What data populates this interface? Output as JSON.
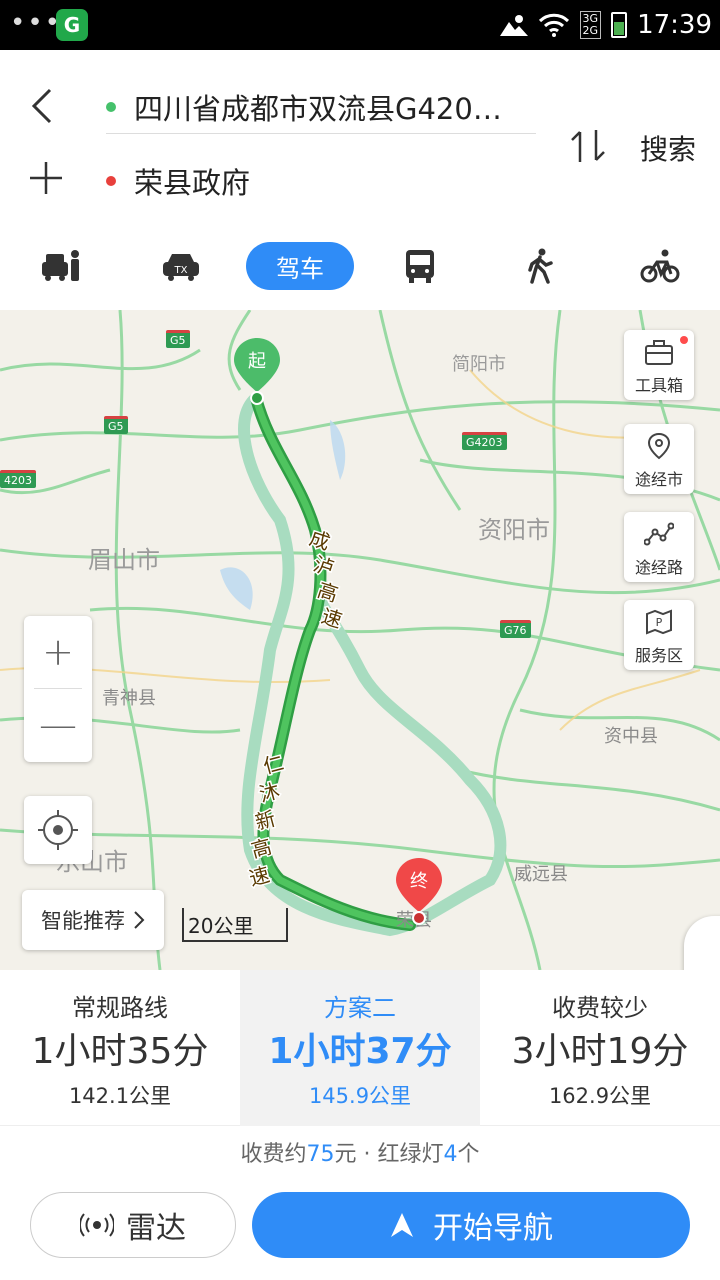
{
  "status_bar": {
    "dots": "•••",
    "app_icon": "G",
    "network": "3G\n2G",
    "time": "17:39"
  },
  "header": {
    "back_icon": "chevron-left-icon",
    "add_icon": "plus-icon",
    "start": "四川省成都市双流县G420…",
    "end": "荣县政府",
    "search": "搜索"
  },
  "modes": {
    "items": [
      "taxi-share-icon",
      "taxi-icon",
      "驾车",
      "bus-icon",
      "walk-icon",
      "bike-icon"
    ],
    "active_label": "驾车"
  },
  "map": {
    "cities": [
      "简阳市",
      "资阳市",
      "眉山市",
      "青神县",
      "资中县",
      "威远县",
      "乐山市",
      "荣县"
    ],
    "shields": [
      "G5",
      "G5",
      "G4203",
      "4203",
      "G76"
    ],
    "route_labels": [
      "成泸高速",
      "仁沐新高速"
    ],
    "start_marker": "起",
    "end_marker": "终",
    "tools": [
      "工具箱",
      "途经市",
      "途经路",
      "服务区"
    ],
    "zoom_in": "+",
    "zoom_out": "—",
    "smart": "智能推荐",
    "scale": "20公里"
  },
  "routes": [
    {
      "name": "常规路线",
      "time": "1小时35分",
      "dist": "142.1公里"
    },
    {
      "name": "方案二",
      "time": "1小时37分",
      "dist": "145.9公里"
    },
    {
      "name": "收费较少",
      "time": "3小时19分",
      "dist": "162.9公里"
    }
  ],
  "info": {
    "prefix": "收费约",
    "toll": "75",
    "mid": "元 · 红绿灯",
    "lights": "4",
    "suffix": "个"
  },
  "buttons": {
    "radar": "雷达",
    "navigate": "开始导航"
  },
  "colors": {
    "accent": "#2f8cf7",
    "route_main": "#3cb54a",
    "route_alt": "#a8dcc0"
  }
}
